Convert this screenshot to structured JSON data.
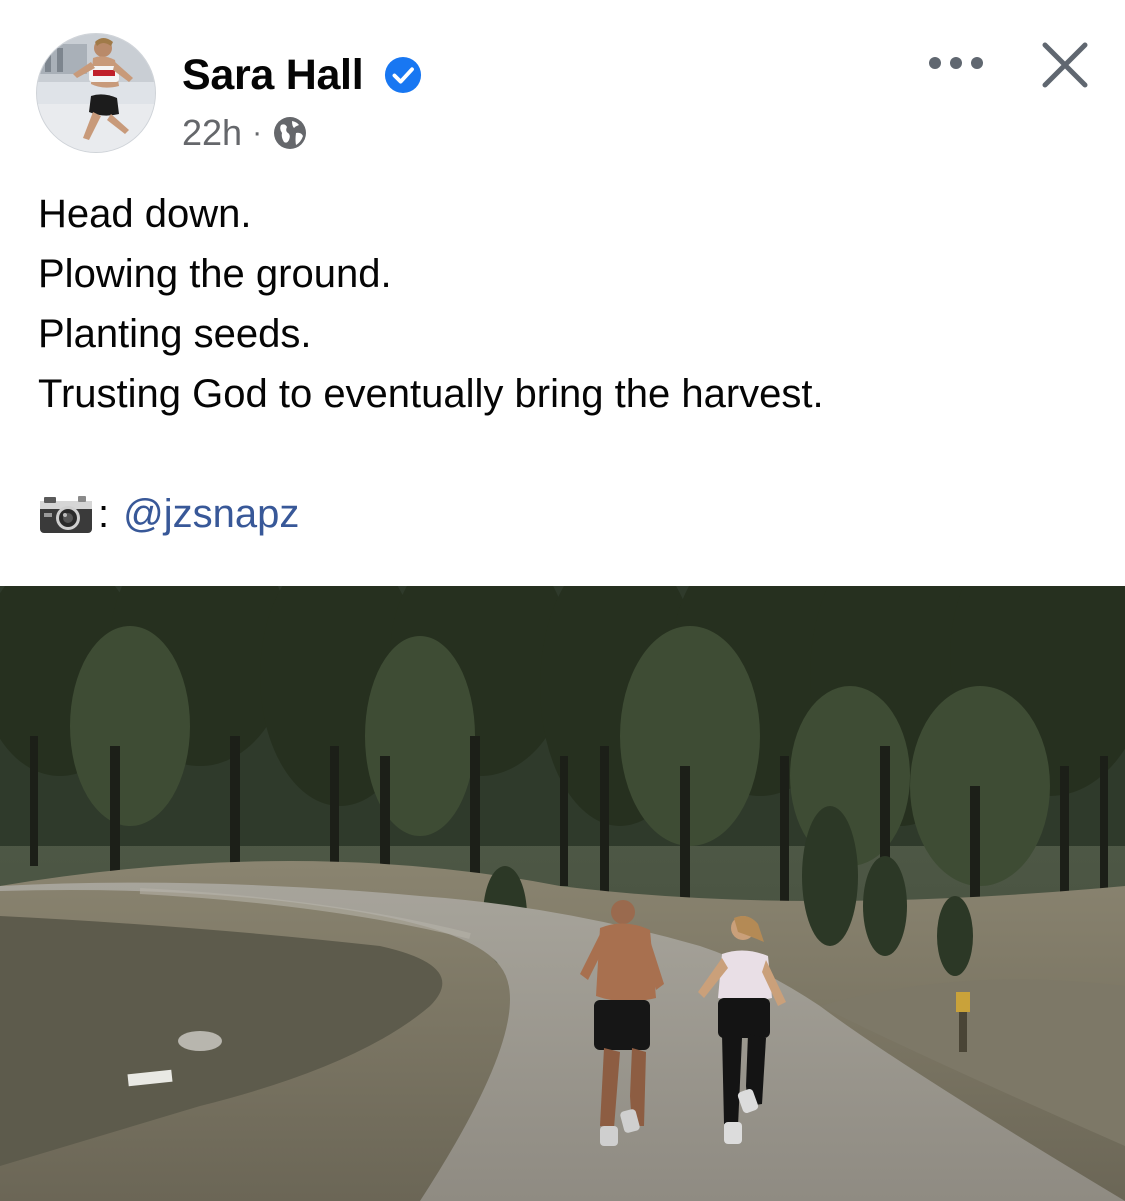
{
  "author": {
    "name": "Sara Hall",
    "verified": true,
    "verified_color": "#1877f2"
  },
  "meta": {
    "timestamp": "22h",
    "separator": "·",
    "audience_icon": "globe-icon"
  },
  "actions": {
    "more_icon": "more-horizontal-icon",
    "close_icon": "close-icon"
  },
  "post": {
    "lines": [
      "Head down.",
      "Plowing the ground.",
      "Planting seeds.",
      "Trusting God to eventually bring the harvest."
    ],
    "credit": {
      "icon": "camera-icon",
      "separator": ":",
      "mention": "@jzsnapz"
    }
  },
  "photo": {
    "icon": "photo-runners-forest-road"
  },
  "colors": {
    "text": "#050505",
    "secondary": "#65676b",
    "link": "#385898"
  }
}
